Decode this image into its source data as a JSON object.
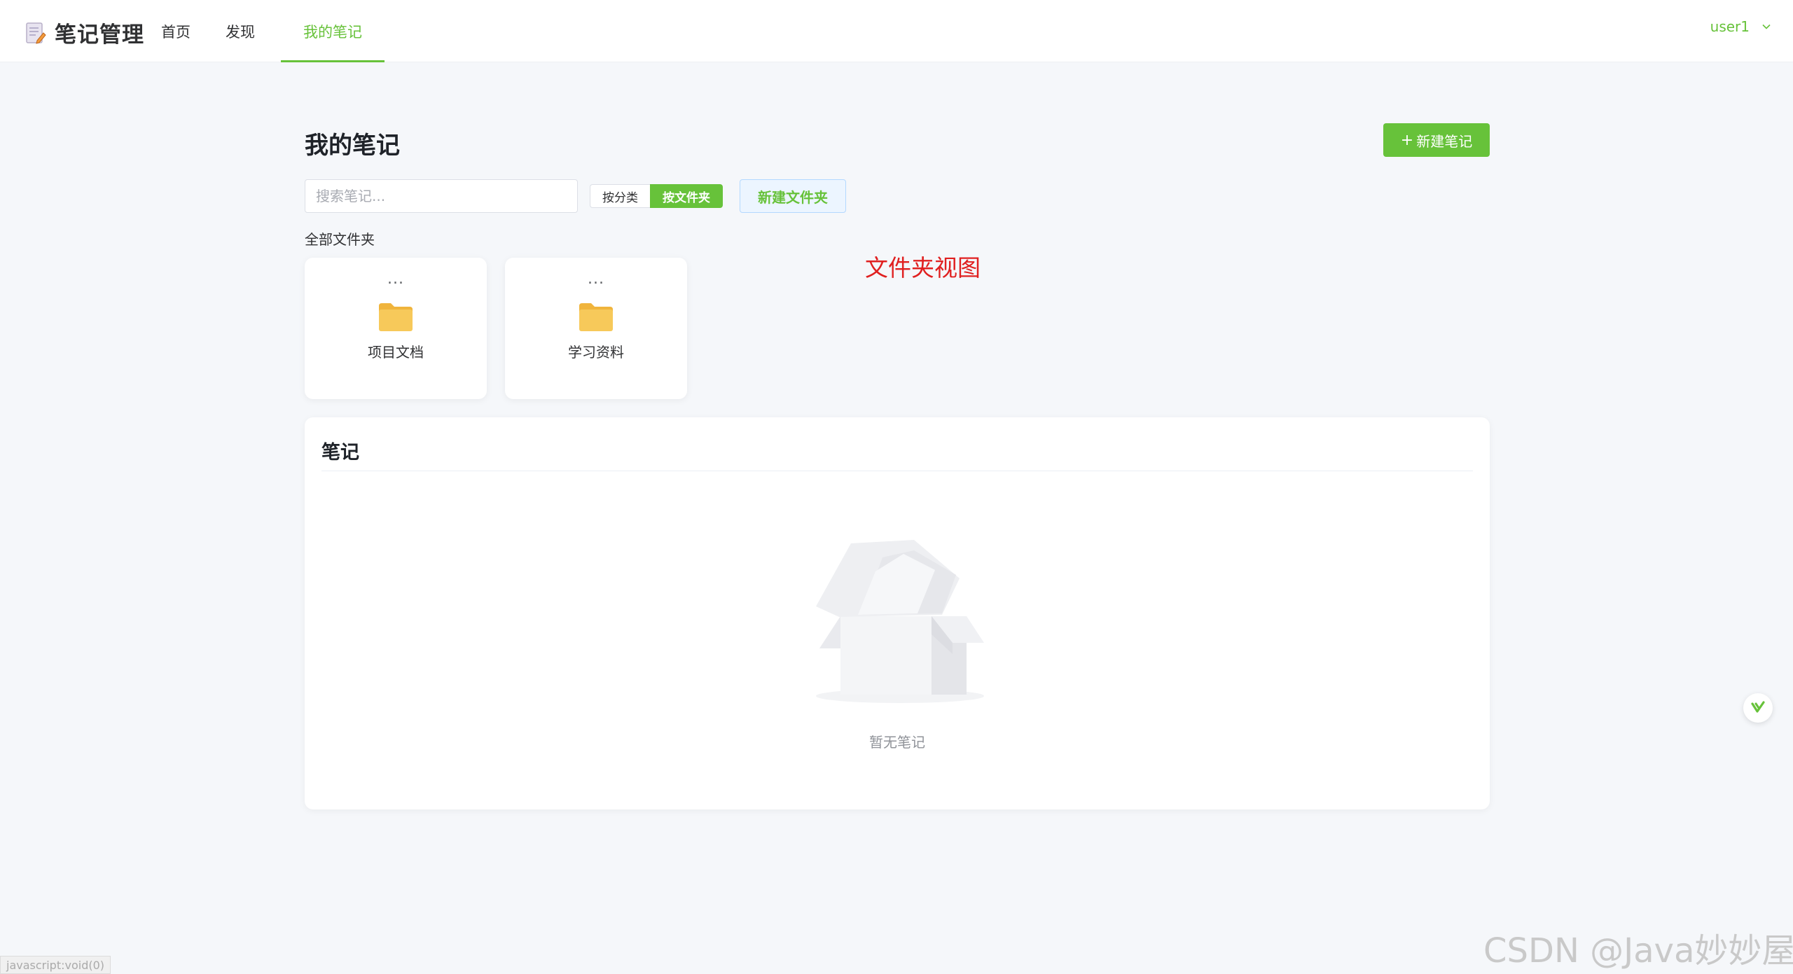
{
  "brand": {
    "title": "笔记管理"
  },
  "nav": {
    "items": [
      {
        "label": "首页"
      },
      {
        "label": "发现"
      },
      {
        "label": "我的笔记",
        "active": true
      }
    ]
  },
  "user": {
    "name": "user1"
  },
  "main": {
    "title": "我的笔记",
    "new_note_label": "新建笔记",
    "search_placeholder": "搜索笔记...",
    "view_toggle": [
      "按分类",
      "按文件夹"
    ],
    "view_toggle_selected": "按文件夹",
    "new_folder_label": "新建文件夹",
    "folders_section_label": "全部文件夹",
    "annotation": "文件夹视图",
    "folders": [
      {
        "name": "项目文档",
        "more": "..."
      },
      {
        "name": "学习资料",
        "more": "..."
      }
    ],
    "notes_title": "笔记",
    "empty_text": "暂无笔记"
  },
  "footer": {
    "status_url": "javascript:void(0)",
    "watermark": "CSDN @Java妙妙屋"
  },
  "colors": {
    "accent": "#67c23a",
    "annotation": "#e02020",
    "folder": "#f5c04a"
  }
}
